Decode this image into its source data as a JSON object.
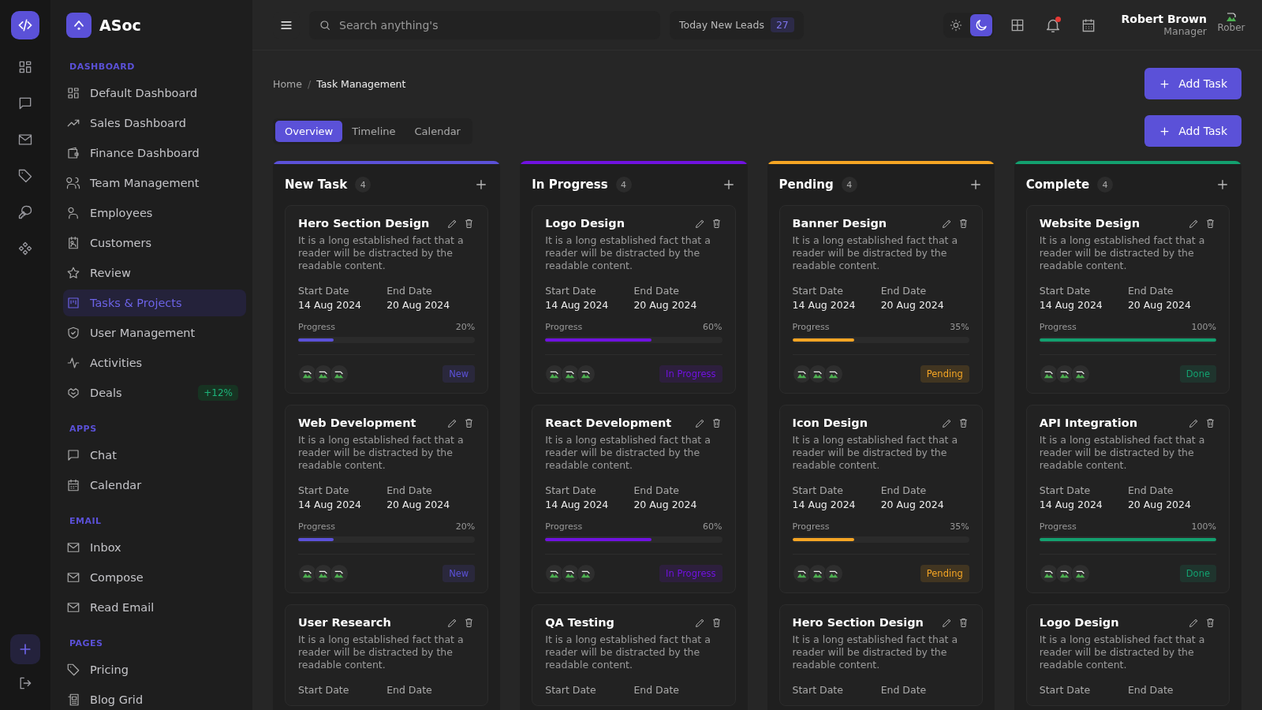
{
  "brand": {
    "name": "ASoc"
  },
  "sidebar": {
    "sections": [
      {
        "title": "DASHBOARD",
        "items": [
          {
            "label": "Default Dashboard",
            "selected": false
          },
          {
            "label": "Sales Dashboard",
            "selected": false
          },
          {
            "label": "Finance Dashboard",
            "selected": false
          },
          {
            "label": "Team Management",
            "selected": false
          },
          {
            "label": "Employees",
            "selected": false
          },
          {
            "label": "Customers",
            "selected": false
          },
          {
            "label": "Review",
            "selected": false
          },
          {
            "label": "Tasks & Projects",
            "selected": true
          },
          {
            "label": "User Management",
            "selected": false
          },
          {
            "label": "Activities",
            "selected": false
          },
          {
            "label": "Deals",
            "selected": false,
            "badge": "+12%"
          }
        ]
      },
      {
        "title": "APPS",
        "items": [
          {
            "label": "Chat",
            "selected": false
          },
          {
            "label": "Calendar",
            "selected": false
          }
        ]
      },
      {
        "title": "EMAIL",
        "items": [
          {
            "label": "Inbox",
            "selected": false
          },
          {
            "label": "Compose",
            "selected": false
          },
          {
            "label": "Read Email",
            "selected": false
          }
        ]
      },
      {
        "title": "PAGES",
        "items": [
          {
            "label": "Pricing",
            "selected": false
          },
          {
            "label": "Blog Grid",
            "selected": false
          }
        ]
      }
    ]
  },
  "topbar": {
    "search": {
      "placeholder": "Search anything's"
    },
    "leads": {
      "label": "Today New Leads",
      "count": "27"
    },
    "theme_toggle": [
      {
        "selected": false
      },
      {
        "selected": true
      }
    ],
    "notifications": {
      "unread": true
    },
    "user": {
      "name": "Robert Brown",
      "role": "Manager",
      "avatar_alt": "Rober"
    }
  },
  "breadcrumb": {
    "items": [
      "Home",
      "Task Management"
    ],
    "separator": "/"
  },
  "add_buttons": [
    "Add Task",
    "Add Task"
  ],
  "tabs": [
    {
      "label": "Overview",
      "selected": true
    },
    {
      "label": "Timeline",
      "selected": false
    },
    {
      "label": "Calendar",
      "selected": false
    }
  ],
  "columns": [
    {
      "title": "New Task",
      "count": "4",
      "color": "#5b51d8",
      "cards": [
        {
          "title": "Hero Section Design",
          "description": "It is a long established fact that a reader will be distracted by the readable content.",
          "start_label": "Start Date",
          "start": "14 Aug 2024",
          "end_label": "End Date",
          "end": "20 Aug 2024",
          "progress_label": "Progress",
          "percent": "20%",
          "level": 0.2,
          "status": "New"
        },
        {
          "title": "Web Development",
          "description": "It is a long established fact that a reader will be distracted by the readable content.",
          "start_label": "Start Date",
          "start": "14 Aug 2024",
          "end_label": "End Date",
          "end": "20 Aug 2024",
          "progress_label": "Progress",
          "percent": "20%",
          "level": 0.2,
          "status": "New"
        },
        {
          "title": "User Research",
          "description": "It is a long established fact that a reader will be distracted by the readable content.",
          "start_label": "Start Date",
          "end_label": "End Date"
        }
      ]
    },
    {
      "title": "In Progress",
      "count": "4",
      "color": "#7012e0",
      "cards": [
        {
          "title": "Logo Design",
          "description": "It is a long established fact that a reader will be distracted by the readable content.",
          "start_label": "Start Date",
          "start": "14 Aug 2024",
          "end_label": "End Date",
          "end": "20 Aug 2024",
          "progress_label": "Progress",
          "percent": "60%",
          "level": 0.6,
          "status": "In Progress"
        },
        {
          "title": "React Development",
          "description": "It is a long established fact that a reader will be distracted by the readable content.",
          "start_label": "Start Date",
          "start": "14 Aug 2024",
          "end_label": "End Date",
          "end": "20 Aug 2024",
          "progress_label": "Progress",
          "percent": "60%",
          "level": 0.6,
          "status": "In Progress"
        },
        {
          "title": "QA Testing",
          "description": "It is a long established fact that a reader will be distracted by the readable content.",
          "start_label": "Start Date",
          "end_label": "End Date"
        }
      ]
    },
    {
      "title": "Pending",
      "count": "4",
      "color": "#f5a524",
      "cards": [
        {
          "title": "Banner Design",
          "description": "It is a long established fact that a reader will be distracted by the readable content.",
          "start_label": "Start Date",
          "start": "14 Aug 2024",
          "end_label": "End Date",
          "end": "20 Aug 2024",
          "progress_label": "Progress",
          "percent": "35%",
          "level": 0.35,
          "status": "Pending"
        },
        {
          "title": "Icon Design",
          "description": "It is a long established fact that a reader will be distracted by the readable content.",
          "start_label": "Start Date",
          "start": "14 Aug 2024",
          "end_label": "End Date",
          "end": "20 Aug 2024",
          "progress_label": "Progress",
          "percent": "35%",
          "level": 0.35,
          "status": "Pending"
        },
        {
          "title": "Hero Section Design",
          "description": "It is a long established fact that a reader will be distracted by the readable content.",
          "start_label": "Start Date",
          "end_label": "End Date"
        }
      ]
    },
    {
      "title": "Complete",
      "count": "4",
      "color": "#13a06f",
      "cards": [
        {
          "title": "Website Design",
          "description": "It is a long established fact that a reader will be distracted by the readable content.",
          "start_label": "Start Date",
          "start": "14 Aug 2024",
          "end_label": "End Date",
          "end": "20 Aug 2024",
          "progress_label": "Progress",
          "percent": "100%",
          "level": 1,
          "status": "Done"
        },
        {
          "title": "API Integration",
          "description": "It is a long established fact that a reader will be distracted by the readable content.",
          "start_label": "Start Date",
          "start": "14 Aug 2024",
          "end_label": "End Date",
          "end": "20 Aug 2024",
          "progress_label": "Progress",
          "percent": "100%",
          "level": 1,
          "status": "Done"
        },
        {
          "title": "Logo Design",
          "description": "It is a long established fact that a reader will be distracted by the readable content.",
          "start_label": "Start Date",
          "end_label": "End Date"
        }
      ]
    }
  ]
}
